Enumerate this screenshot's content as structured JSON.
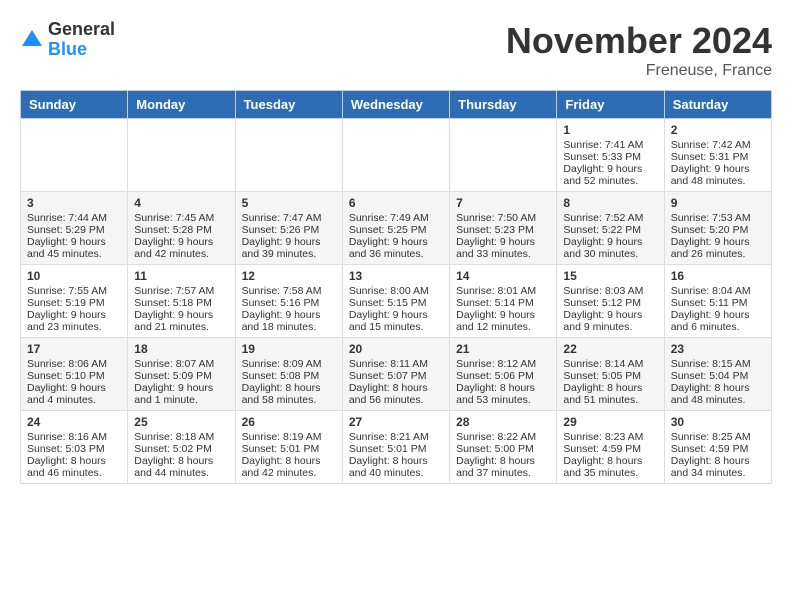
{
  "header": {
    "logo_general": "General",
    "logo_blue": "Blue",
    "month_title": "November 2024",
    "location": "Freneuse, France"
  },
  "weekdays": [
    "Sunday",
    "Monday",
    "Tuesday",
    "Wednesday",
    "Thursday",
    "Friday",
    "Saturday"
  ],
  "weeks": [
    [
      {
        "day": "",
        "sunrise": "",
        "sunset": "",
        "daylight": ""
      },
      {
        "day": "",
        "sunrise": "",
        "sunset": "",
        "daylight": ""
      },
      {
        "day": "",
        "sunrise": "",
        "sunset": "",
        "daylight": ""
      },
      {
        "day": "",
        "sunrise": "",
        "sunset": "",
        "daylight": ""
      },
      {
        "day": "",
        "sunrise": "",
        "sunset": "",
        "daylight": ""
      },
      {
        "day": "1",
        "sunrise": "Sunrise: 7:41 AM",
        "sunset": "Sunset: 5:33 PM",
        "daylight": "Daylight: 9 hours and 52 minutes."
      },
      {
        "day": "2",
        "sunrise": "Sunrise: 7:42 AM",
        "sunset": "Sunset: 5:31 PM",
        "daylight": "Daylight: 9 hours and 48 minutes."
      }
    ],
    [
      {
        "day": "3",
        "sunrise": "Sunrise: 7:44 AM",
        "sunset": "Sunset: 5:29 PM",
        "daylight": "Daylight: 9 hours and 45 minutes."
      },
      {
        "day": "4",
        "sunrise": "Sunrise: 7:45 AM",
        "sunset": "Sunset: 5:28 PM",
        "daylight": "Daylight: 9 hours and 42 minutes."
      },
      {
        "day": "5",
        "sunrise": "Sunrise: 7:47 AM",
        "sunset": "Sunset: 5:26 PM",
        "daylight": "Daylight: 9 hours and 39 minutes."
      },
      {
        "day": "6",
        "sunrise": "Sunrise: 7:49 AM",
        "sunset": "Sunset: 5:25 PM",
        "daylight": "Daylight: 9 hours and 36 minutes."
      },
      {
        "day": "7",
        "sunrise": "Sunrise: 7:50 AM",
        "sunset": "Sunset: 5:23 PM",
        "daylight": "Daylight: 9 hours and 33 minutes."
      },
      {
        "day": "8",
        "sunrise": "Sunrise: 7:52 AM",
        "sunset": "Sunset: 5:22 PM",
        "daylight": "Daylight: 9 hours and 30 minutes."
      },
      {
        "day": "9",
        "sunrise": "Sunrise: 7:53 AM",
        "sunset": "Sunset: 5:20 PM",
        "daylight": "Daylight: 9 hours and 26 minutes."
      }
    ],
    [
      {
        "day": "10",
        "sunrise": "Sunrise: 7:55 AM",
        "sunset": "Sunset: 5:19 PM",
        "daylight": "Daylight: 9 hours and 23 minutes."
      },
      {
        "day": "11",
        "sunrise": "Sunrise: 7:57 AM",
        "sunset": "Sunset: 5:18 PM",
        "daylight": "Daylight: 9 hours and 21 minutes."
      },
      {
        "day": "12",
        "sunrise": "Sunrise: 7:58 AM",
        "sunset": "Sunset: 5:16 PM",
        "daylight": "Daylight: 9 hours and 18 minutes."
      },
      {
        "day": "13",
        "sunrise": "Sunrise: 8:00 AM",
        "sunset": "Sunset: 5:15 PM",
        "daylight": "Daylight: 9 hours and 15 minutes."
      },
      {
        "day": "14",
        "sunrise": "Sunrise: 8:01 AM",
        "sunset": "Sunset: 5:14 PM",
        "daylight": "Daylight: 9 hours and 12 minutes."
      },
      {
        "day": "15",
        "sunrise": "Sunrise: 8:03 AM",
        "sunset": "Sunset: 5:12 PM",
        "daylight": "Daylight: 9 hours and 9 minutes."
      },
      {
        "day": "16",
        "sunrise": "Sunrise: 8:04 AM",
        "sunset": "Sunset: 5:11 PM",
        "daylight": "Daylight: 9 hours and 6 minutes."
      }
    ],
    [
      {
        "day": "17",
        "sunrise": "Sunrise: 8:06 AM",
        "sunset": "Sunset: 5:10 PM",
        "daylight": "Daylight: 9 hours and 4 minutes."
      },
      {
        "day": "18",
        "sunrise": "Sunrise: 8:07 AM",
        "sunset": "Sunset: 5:09 PM",
        "daylight": "Daylight: 9 hours and 1 minute."
      },
      {
        "day": "19",
        "sunrise": "Sunrise: 8:09 AM",
        "sunset": "Sunset: 5:08 PM",
        "daylight": "Daylight: 8 hours and 58 minutes."
      },
      {
        "day": "20",
        "sunrise": "Sunrise: 8:11 AM",
        "sunset": "Sunset: 5:07 PM",
        "daylight": "Daylight: 8 hours and 56 minutes."
      },
      {
        "day": "21",
        "sunrise": "Sunrise: 8:12 AM",
        "sunset": "Sunset: 5:06 PM",
        "daylight": "Daylight: 8 hours and 53 minutes."
      },
      {
        "day": "22",
        "sunrise": "Sunrise: 8:14 AM",
        "sunset": "Sunset: 5:05 PM",
        "daylight": "Daylight: 8 hours and 51 minutes."
      },
      {
        "day": "23",
        "sunrise": "Sunrise: 8:15 AM",
        "sunset": "Sunset: 5:04 PM",
        "daylight": "Daylight: 8 hours and 48 minutes."
      }
    ],
    [
      {
        "day": "24",
        "sunrise": "Sunrise: 8:16 AM",
        "sunset": "Sunset: 5:03 PM",
        "daylight": "Daylight: 8 hours and 46 minutes."
      },
      {
        "day": "25",
        "sunrise": "Sunrise: 8:18 AM",
        "sunset": "Sunset: 5:02 PM",
        "daylight": "Daylight: 8 hours and 44 minutes."
      },
      {
        "day": "26",
        "sunrise": "Sunrise: 8:19 AM",
        "sunset": "Sunset: 5:01 PM",
        "daylight": "Daylight: 8 hours and 42 minutes."
      },
      {
        "day": "27",
        "sunrise": "Sunrise: 8:21 AM",
        "sunset": "Sunset: 5:01 PM",
        "daylight": "Daylight: 8 hours and 40 minutes."
      },
      {
        "day": "28",
        "sunrise": "Sunrise: 8:22 AM",
        "sunset": "Sunset: 5:00 PM",
        "daylight": "Daylight: 8 hours and 37 minutes."
      },
      {
        "day": "29",
        "sunrise": "Sunrise: 8:23 AM",
        "sunset": "Sunset: 4:59 PM",
        "daylight": "Daylight: 8 hours and 35 minutes."
      },
      {
        "day": "30",
        "sunrise": "Sunrise: 8:25 AM",
        "sunset": "Sunset: 4:59 PM",
        "daylight": "Daylight: 8 hours and 34 minutes."
      }
    ]
  ]
}
